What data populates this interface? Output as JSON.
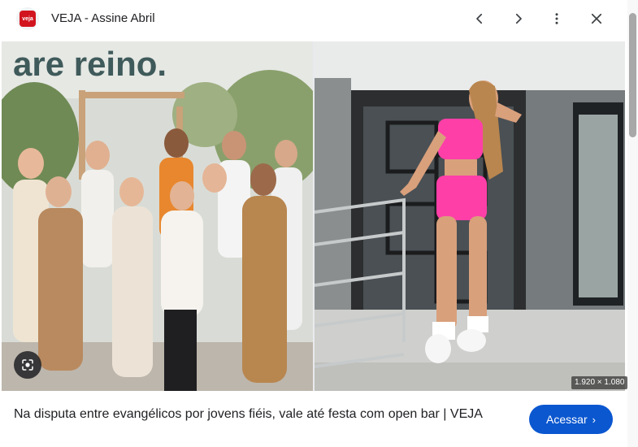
{
  "header": {
    "favicon_text": "veja",
    "title": "VEJA - Assine Abril",
    "prev_icon": "chevron-left-icon",
    "next_icon": "chevron-right-icon",
    "more_icon": "more-vert-icon",
    "close_icon": "close-icon"
  },
  "images": {
    "left_sign_text": "are reino.",
    "dimensions": "1.920 × 1.080",
    "lens_icon": "lens-search-icon"
  },
  "caption": {
    "text": "Na disputa entre evangélicos por jovens fiéis, vale até festa com open bar | VEJA"
  },
  "access_button": {
    "label": "Acessar",
    "chevron": "›"
  },
  "colors": {
    "accent": "#0b57d0",
    "veja_red": "#d2141e"
  }
}
